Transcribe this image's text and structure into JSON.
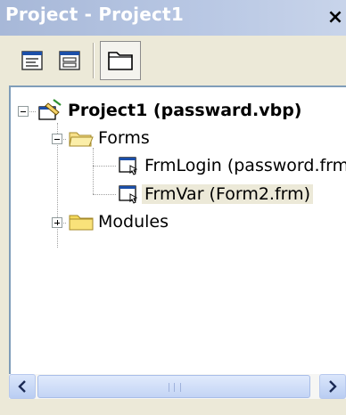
{
  "window": {
    "title": "Project - Project1",
    "close_label": "×"
  },
  "toolbar": {
    "buttons": [
      {
        "name": "view-code",
        "icon": "view-code-icon"
      },
      {
        "name": "view-object",
        "icon": "view-object-icon"
      },
      {
        "name": "toggle-folders",
        "icon": "folder-icon",
        "pressed": true
      }
    ]
  },
  "tree": {
    "root": {
      "label": "Project1 (passward.vbp)",
      "icon": "project-icon",
      "expanded": true
    },
    "forms": {
      "label": "Forms",
      "icon": "open-folder-icon",
      "expanded": true
    },
    "form_items": [
      {
        "label": "FrmLogin (password.frm)",
        "icon": "form-icon",
        "selected": false
      },
      {
        "label": "FrmVar (Form2.frm)",
        "icon": "form-icon",
        "selected": true
      }
    ],
    "modules": {
      "label": "Modules",
      "icon": "closed-folder-icon",
      "expanded": false
    }
  },
  "colors": {
    "titlebar": "#b0c2e0",
    "selection": "#ece9d8",
    "scroll_accent": "#c3d4f5"
  }
}
